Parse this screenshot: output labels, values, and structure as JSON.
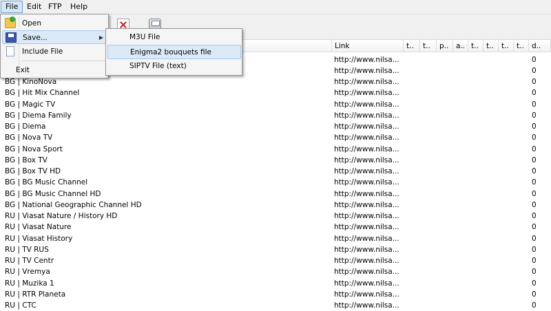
{
  "menubar": {
    "items": [
      {
        "label": "File"
      },
      {
        "label": "Edit"
      },
      {
        "label": "FTP"
      },
      {
        "label": "Help"
      }
    ]
  },
  "toolbar": {
    "icons": [
      "delete-icon",
      "print-icon"
    ]
  },
  "file_menu": {
    "items": [
      {
        "label": "Open",
        "icon": "open-folder-icon"
      },
      {
        "label": "Save...",
        "icon": "save-icon",
        "submenu": true
      },
      {
        "label": "Include File",
        "icon": "file-icon"
      },
      {
        "label": "Exit"
      }
    ]
  },
  "save_submenu": {
    "items": [
      {
        "label": "M3U File"
      },
      {
        "label": "Enigma2 bouquets file",
        "highlighted": true
      },
      {
        "label": "SIPTV File (text)"
      }
    ]
  },
  "table": {
    "headers": [
      "Link",
      "t..",
      "t..",
      "p..",
      "a..",
      "t..",
      "t..",
      "t..",
      "t..",
      "d.."
    ],
    "rows": [
      {
        "name": "",
        "link": "http://www.nilsa...",
        "d": "0"
      },
      {
        "name": "",
        "link": "http://www.nilsa...",
        "d": "0"
      },
      {
        "name": "BG | KinoNova",
        "link": "http://www.nilsa...",
        "d": "0"
      },
      {
        "name": "BG | Hit Mix Channel",
        "link": "http://www.nilsa...",
        "d": "0"
      },
      {
        "name": "BG | Magic TV",
        "link": "http://www.nilsa...",
        "d": "0"
      },
      {
        "name": "BG | Diema Family",
        "link": "http://www.nilsa...",
        "d": "0"
      },
      {
        "name": "BG | Diema",
        "link": "http://www.nilsa...",
        "d": "0"
      },
      {
        "name": "BG | Nova TV",
        "link": "http://www.nilsa...",
        "d": "0"
      },
      {
        "name": "BG | Nova Sport",
        "link": "http://www.nilsa...",
        "d": "0"
      },
      {
        "name": "BG | Box TV",
        "link": "http://www.nilsa...",
        "d": "0"
      },
      {
        "name": "BG | Box TV HD",
        "link": "http://www.nilsa...",
        "d": "0"
      },
      {
        "name": "BG | BG Music Channel",
        "link": "http://www.nilsa...",
        "d": "0"
      },
      {
        "name": "BG | BG Music Channel HD",
        "link": "http://www.nilsa...",
        "d": "0"
      },
      {
        "name": "BG | National Geographic Channel HD",
        "link": "http://www.nilsa...",
        "d": "0"
      },
      {
        "name": "RU | Viasat Nature / History HD",
        "link": "http://www.nilsa...",
        "d": "0"
      },
      {
        "name": "RU | Viasat Nature",
        "link": "http://www.nilsa...",
        "d": "0"
      },
      {
        "name": "RU | Viasat History",
        "link": "http://www.nilsa...",
        "d": "0"
      },
      {
        "name": "RU | TV RUS",
        "link": "http://www.nilsa...",
        "d": "0"
      },
      {
        "name": "RU | TV Centr",
        "link": "http://www.nilsa...",
        "d": "0"
      },
      {
        "name": "RU | Vremya",
        "link": "http://www.nilsa...",
        "d": "0"
      },
      {
        "name": "RU | Muzika 1",
        "link": "http://www.nilsa...",
        "d": "0"
      },
      {
        "name": "RU | RTR Planeta",
        "link": "http://www.nilsa...",
        "d": "0"
      },
      {
        "name": "RU | CTC",
        "link": "http://www.nilsa...",
        "d": "0"
      }
    ]
  },
  "colors": {
    "menu_highlight": "#dbe9f8",
    "menu_highlight_border": "#a8c8ea",
    "menubar_bg": "#f0f0f0"
  }
}
